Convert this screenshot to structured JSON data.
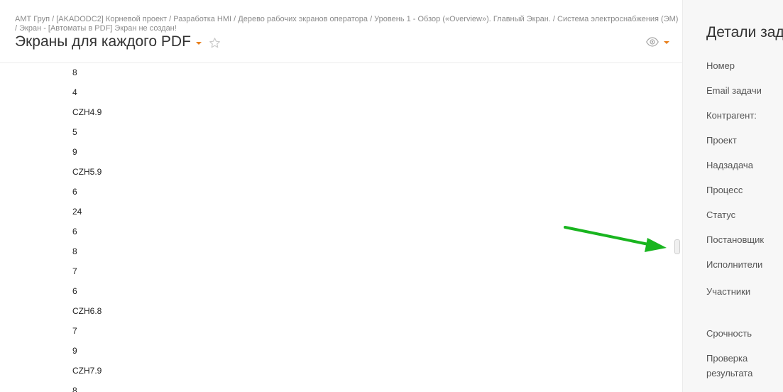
{
  "header": {
    "breadcrumb": "АМТ Груп / [AKADODC2] Корневой проект / Разработка HMI / Дерево рабочих экранов оператора / Уровень 1 - Обзор («Overview»). Главный Экран. / Система электроснабжения (ЭМ) / Экран - [Автоматы в PDF] Экран не создан!",
    "title": "Экраны для каждого PDF",
    "accent_color": "#e87f1c",
    "icons": [
      "star-icon",
      "eye-icon",
      "caret-down-icon"
    ]
  },
  "content": {
    "values": [
      "8",
      "4",
      "CZH4.9",
      "5",
      "9",
      "CZH5.9",
      "6",
      "24",
      "6",
      "8",
      "7",
      "6",
      "CZH6.8",
      "7",
      "9",
      "CZH7.9",
      "8"
    ]
  },
  "annotation": {
    "arrow_color": "#19b51f"
  },
  "details": {
    "title": "Детали задачи",
    "fields": [
      "Номер",
      "Email задачи",
      "Контрагент:",
      "Проект",
      "Надзадача",
      "Процесс",
      "Статус",
      "Постановщик",
      "Исполнители",
      "Участники",
      "Срочность",
      "Проверка результата"
    ]
  }
}
